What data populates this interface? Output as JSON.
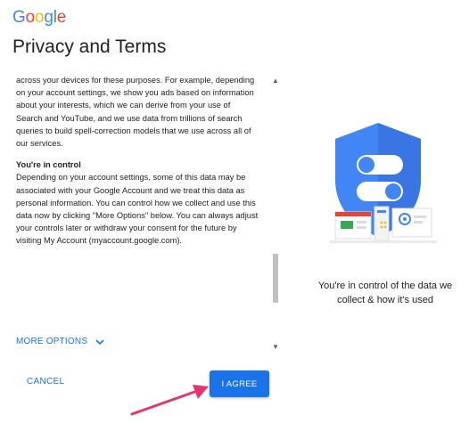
{
  "brand": {
    "letters": [
      {
        "ch": "G",
        "color": "#4285F4"
      },
      {
        "ch": "o",
        "color": "#EA4335"
      },
      {
        "ch": "o",
        "color": "#FBBC05"
      },
      {
        "ch": "g",
        "color": "#4285F4"
      },
      {
        "ch": "l",
        "color": "#34A853"
      },
      {
        "ch": "e",
        "color": "#EA4335"
      }
    ]
  },
  "page": {
    "title": "Privacy and Terms"
  },
  "terms": {
    "paragraph_1": "across your devices for these purposes. For example, depending on your account settings, we show you ads based on information about your interests, which we can derive from your use of Search and YouTube, and we use data from trillions of search queries to build spell-correction models that we use across all of our services.",
    "heading_2": "You're in control",
    "paragraph_2": "Depending on your account settings, some of this data may be associated with your Google Account and we treat this data as personal information. You can control how we collect and use this data now by clicking \"More Options\" below. You can always adjust your controls later or withdraw your consent for the future by visiting My Account (myaccount.google.com)."
  },
  "scroll": {
    "position_fraction": 0.82
  },
  "actions": {
    "more_options_label": "MORE OPTIONS",
    "cancel_label": "CANCEL",
    "agree_label": "I AGREE"
  },
  "side_panel": {
    "caption_line_1": "You're in control of the data we",
    "caption_line_2": "collect & how it's used"
  },
  "icons": {
    "more_options": "chevron-down-icon",
    "scroll_up": "arrow-up-icon",
    "scroll_down": "arrow-down-icon",
    "annotation": "arrow-icon",
    "illustration": "shield-icon"
  },
  "colors": {
    "accent": "#1a73e8",
    "shield_blue": "#4285F4",
    "shield_shade": "#3367D6",
    "annotation_arrow": "#E8336F"
  }
}
